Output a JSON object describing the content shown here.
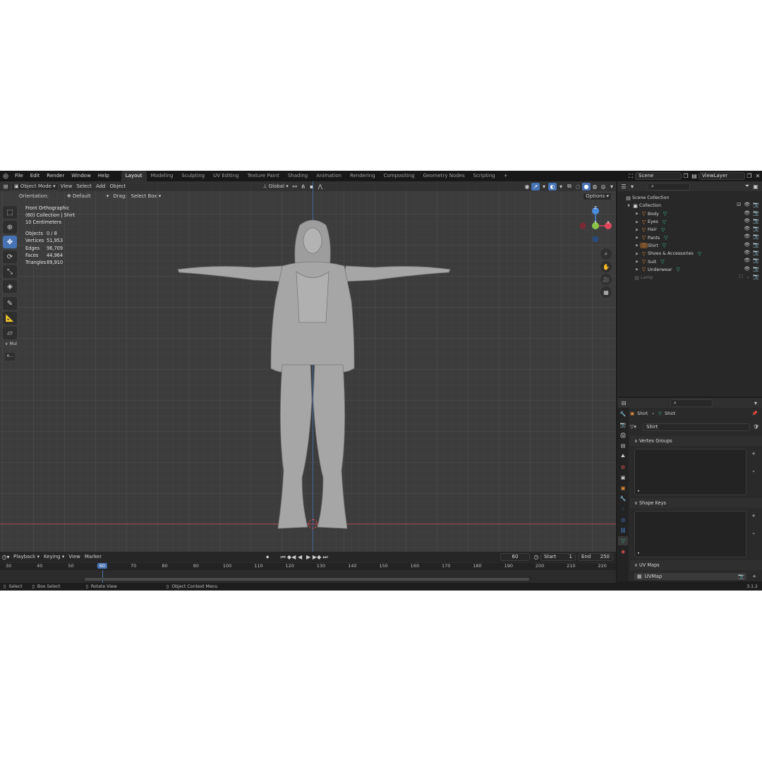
{
  "menu": [
    "File",
    "Edit",
    "Render",
    "Window",
    "Help"
  ],
  "workspaces": [
    "Layout",
    "Modeling",
    "Sculpting",
    "UV Editing",
    "Texture Paint",
    "Shading",
    "Animation",
    "Rendering",
    "Compositing",
    "Geometry Nodes",
    "Scripting"
  ],
  "active_workspace": "Layout",
  "scene_field": "Scene",
  "view_layer_field": "ViewLayer",
  "viewport": {
    "mode": "Object Mode",
    "menus": [
      "View",
      "Select",
      "Add",
      "Object"
    ],
    "transform_orientation": "Global",
    "orientation_label": "Orientation:",
    "orientation_value": "Default",
    "drag_label": "Drag:",
    "drag_value": "Select Box",
    "options_label": "Options",
    "view_name": "Front Orthographic",
    "collection_info": "(60) Collection | Shirt",
    "scale_info": "10 Centimeters",
    "stats": [
      {
        "label": "Objects",
        "value": "0 / 8"
      },
      {
        "label": "Vertices",
        "value": "51,953"
      },
      {
        "label": "Edges",
        "value": "96,709"
      },
      {
        "label": "Faces",
        "value": "44,964"
      },
      {
        "label": "Triangles",
        "value": "89,910"
      }
    ],
    "gizmo": {
      "x": "X",
      "y": "Y",
      "z": "Z"
    },
    "side_panel_label": "Mul",
    "side_button_label": "A..."
  },
  "outliner": {
    "root": "Scene Collection",
    "collection": "Collection",
    "items": [
      "Body",
      "Eyes",
      "Hair",
      "Pants",
      "Shirt",
      "Shoes & Accessories",
      "Suit",
      "Underwear"
    ],
    "lamp": "Lamp"
  },
  "properties": {
    "breadcrumb_object": "Shirt",
    "breadcrumb_data": "Shirt",
    "data_name": "Shirt",
    "panels": [
      "Vertex Groups",
      "Shape Keys",
      "UV Maps"
    ],
    "uv_map": "UVMap"
  },
  "timeline": {
    "menus": [
      "Playback",
      "Keying",
      "View",
      "Marker"
    ],
    "current_frame": "60",
    "start_label": "Start",
    "start_value": "1",
    "end_label": "End",
    "end_value": "250",
    "ruler": [
      "30",
      "40",
      "50",
      "60",
      "70",
      "80",
      "90",
      "100",
      "110",
      "120",
      "130",
      "140",
      "150",
      "160",
      "170",
      "180",
      "190",
      "200",
      "210",
      "220"
    ]
  },
  "status": {
    "select": "Select",
    "box_select": "Box Select",
    "rotate_view": "Rotate View",
    "context_menu": "Object Context Menu",
    "version": "3.1.2"
  },
  "colors": {
    "accent": "#4772b3",
    "mesh_icon": "#e08e3c",
    "data_icon": "#3ec88a",
    "axis_x": "#e0455d",
    "axis_y": "#8bc34a",
    "axis_z": "#4a8bdb"
  }
}
